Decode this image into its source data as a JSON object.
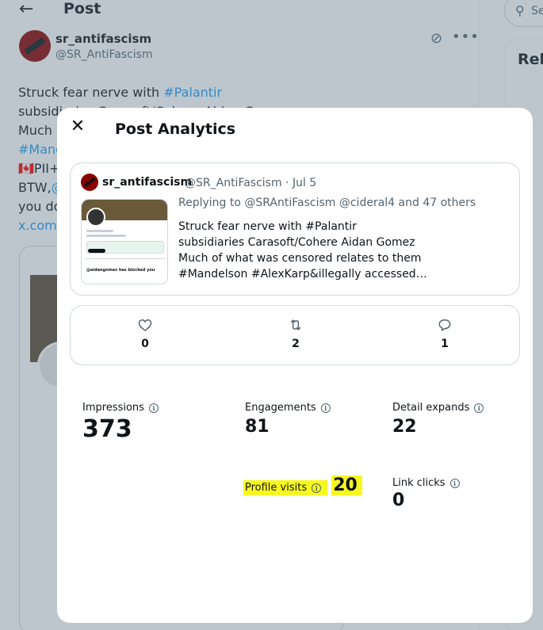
{
  "background": {
    "header_title": "Post",
    "author_name": "sr_antifascism",
    "author_handle": "@SR_AntiFascism",
    "post_lines": [
      {
        "text": "Struck fear nerve with ",
        "link": "#Palantir"
      },
      {
        "text": "subsidiaries Carasoft/Cohere Aidan Gomez",
        "link": ""
      },
      {
        "text": "Much",
        "link": ""
      },
      {
        "text": "",
        "link": "#Mand"
      },
      {
        "text": "🇨🇦PII+",
        "link": ""
      },
      {
        "text": "BTW,",
        "link": "@"
      },
      {
        "text": "you do",
        "link": ""
      },
      {
        "text": "",
        "link": "x.com/"
      }
    ],
    "search_placeholder": "Se",
    "relevant_label": "Rel"
  },
  "modal": {
    "close_icon": "close-icon",
    "title": "Post Analytics",
    "quoted_post": {
      "author_name": "sr_antifascism",
      "meta": "@SR_AntiFascism · Jul 5",
      "replying_to": "Replying to @SRAntiFascism @cideral4 and 47 others",
      "text_lines": [
        "Struck fear nerve with #Palantir",
        "subsidiaries Carasoft/Cohere Aidan Gomez",
        "Much of what was censored relates to them",
        "#Mandelson #AlexKarp&illegally accessed…"
      ],
      "thumbnail_caption": "@aidangomez has blocked you"
    },
    "engagement": {
      "likes": "0",
      "reposts": "2",
      "replies": "1"
    },
    "metrics": {
      "impressions": {
        "label": "Impressions",
        "value": "373"
      },
      "engagements": {
        "label": "Engagements",
        "value": "81"
      },
      "detail_expands": {
        "label": "Detail expands",
        "value": "22"
      },
      "profile_visits": {
        "label": "Profile visits",
        "value": "20"
      },
      "link_clicks": {
        "label": "Link clicks",
        "value": "0"
      }
    },
    "highlight_color": "#f7f720"
  }
}
